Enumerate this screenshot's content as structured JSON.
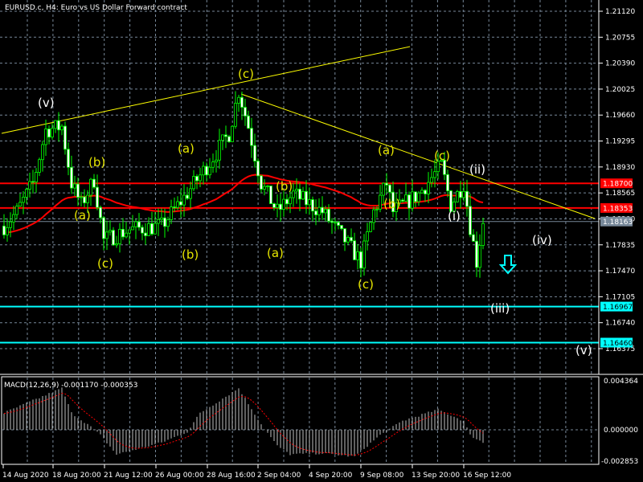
{
  "header": {
    "title": "EURUSD.c, H4:  Euro vs US Dollar Forward contract"
  },
  "price_axis": [
    "1.21120",
    "1.20755",
    "1.20390",
    "1.20025",
    "1.19660",
    "1.19295",
    "1.18930",
    "1.18565",
    "1.18200",
    "1.17835",
    "1.17470",
    "1.17105",
    "1.16740",
    "1.16375"
  ],
  "levels": [
    {
      "label": "1.18700",
      "price": 1.187,
      "color": "#ff0000",
      "text_color": "#ffffff"
    },
    {
      "label": "1.18353",
      "price": 1.18353,
      "color": "#ff0000",
      "text_color": "#ffffff"
    },
    {
      "label": "1.18163",
      "price": 1.18163,
      "color": "#778899",
      "text_color": "#ffffff"
    },
    {
      "label": "1.16967",
      "price": 1.16967,
      "color": "#00ffff",
      "text_color": "#000000"
    },
    {
      "label": "1.16460",
      "price": 1.1646,
      "color": "#00ffff",
      "text_color": "#000000"
    }
  ],
  "time_axis": [
    "14 Aug 2020",
    "18 Aug 20:00",
    "21 Aug 12:00",
    "26 Aug 00:00",
    "28 Aug 16:00",
    "2 Sep 04:00",
    "4 Sep 20:00",
    "9 Sep 08:00",
    "13 Sep 20:00",
    "16 Sep 12:00"
  ],
  "wave_labels": [
    {
      "text": "(v)",
      "color": "#ffffff"
    },
    {
      "text": "(a)",
      "color": "#e6e600"
    },
    {
      "text": "(b)",
      "color": "#e6e600"
    },
    {
      "text": "(c)",
      "color": "#e6e600"
    },
    {
      "text": "(b)",
      "color": "#e6e600"
    },
    {
      "text": "(a)",
      "color": "#e6e600"
    },
    {
      "text": "(c)",
      "color": "#e6e600"
    },
    {
      "text": "(b)",
      "color": "#e6e600"
    },
    {
      "text": "(a)",
      "color": "#e6e600"
    },
    {
      "text": "(c)",
      "color": "#e6e600"
    },
    {
      "text": "(a)",
      "color": "#e6e600"
    },
    {
      "text": "(b)",
      "color": "#e6e600"
    },
    {
      "text": "(c)",
      "color": "#e6e600"
    },
    {
      "text": "(ii)",
      "color": "#ffffff"
    },
    {
      "text": "(i)",
      "color": "#ffffff"
    },
    {
      "text": "(iv)",
      "color": "#ffffff"
    },
    {
      "text": "(iii)",
      "color": "#ffffff"
    },
    {
      "text": "(v)",
      "color": "#ffffff"
    }
  ],
  "macd": {
    "label": "MACD(12,26,9) -0.001170 -0.000353",
    "axis": [
      "0.004364",
      "0.000000",
      "-0.002853"
    ]
  },
  "colors": {
    "candle": "#00ff00",
    "ma": "#ff0000",
    "trendline": "#ffff00",
    "grid": "#778899",
    "arrow": "#00ffff",
    "hist": "#c0c0c0",
    "signal": "#ff0000"
  },
  "chart_data": {
    "type": "candlestick",
    "symbol": "EURUSD.c",
    "timeframe": "H4",
    "ylim": [
      1.1621,
      1.2128
    ],
    "close_path": [
      [
        0,
        1.181
      ],
      [
        4,
        1.183
      ],
      [
        9,
        1.187
      ],
      [
        13,
        1.1945
      ],
      [
        18,
        1.195
      ],
      [
        21,
        1.187
      ],
      [
        24,
        1.184
      ],
      [
        28,
        1.1875
      ],
      [
        31,
        1.179
      ],
      [
        39,
        1.1805
      ],
      [
        49,
        1.181
      ],
      [
        56,
        1.185
      ],
      [
        64,
        1.19
      ],
      [
        70,
        1.194
      ],
      [
        73,
        1.2
      ],
      [
        76,
        1.195
      ],
      [
        80,
        1.187
      ],
      [
        85,
        1.183
      ],
      [
        90,
        1.1855
      ],
      [
        99,
        1.183
      ],
      [
        106,
        1.179
      ],
      [
        111,
        1.176
      ],
      [
        115,
        1.183
      ],
      [
        119,
        1.187
      ],
      [
        121,
        1.183
      ],
      [
        129,
        1.1855
      ],
      [
        136,
        1.1895
      ],
      [
        139,
        1.184
      ],
      [
        143,
        1.187
      ],
      [
        145,
        1.181
      ],
      [
        147,
        1.176
      ],
      [
        149,
        1.1818
      ]
    ],
    "macd_histogram_path": [
      [
        0,
        0.0015
      ],
      [
        9,
        0.0026
      ],
      [
        18,
        0.0037
      ],
      [
        21,
        0.0015
      ],
      [
        26,
        0.0005
      ],
      [
        30,
        -0.0005
      ],
      [
        35,
        -0.0023
      ],
      [
        49,
        -0.0012
      ],
      [
        57,
        -0.0002
      ],
      [
        61,
        0.0015
      ],
      [
        73,
        0.0037
      ],
      [
        80,
        0.0005
      ],
      [
        85,
        -0.0015
      ],
      [
        89,
        -0.0023
      ],
      [
        99,
        -0.0022
      ],
      [
        109,
        -0.0025
      ],
      [
        117,
        -0.0005
      ],
      [
        124,
        0.0008
      ],
      [
        135,
        0.0018
      ],
      [
        143,
        0.0008
      ],
      [
        145,
        -0.0005
      ],
      [
        149,
        -0.0012
      ]
    ],
    "macd_ylim": [
      -0.002853,
      0.004364
    ]
  }
}
